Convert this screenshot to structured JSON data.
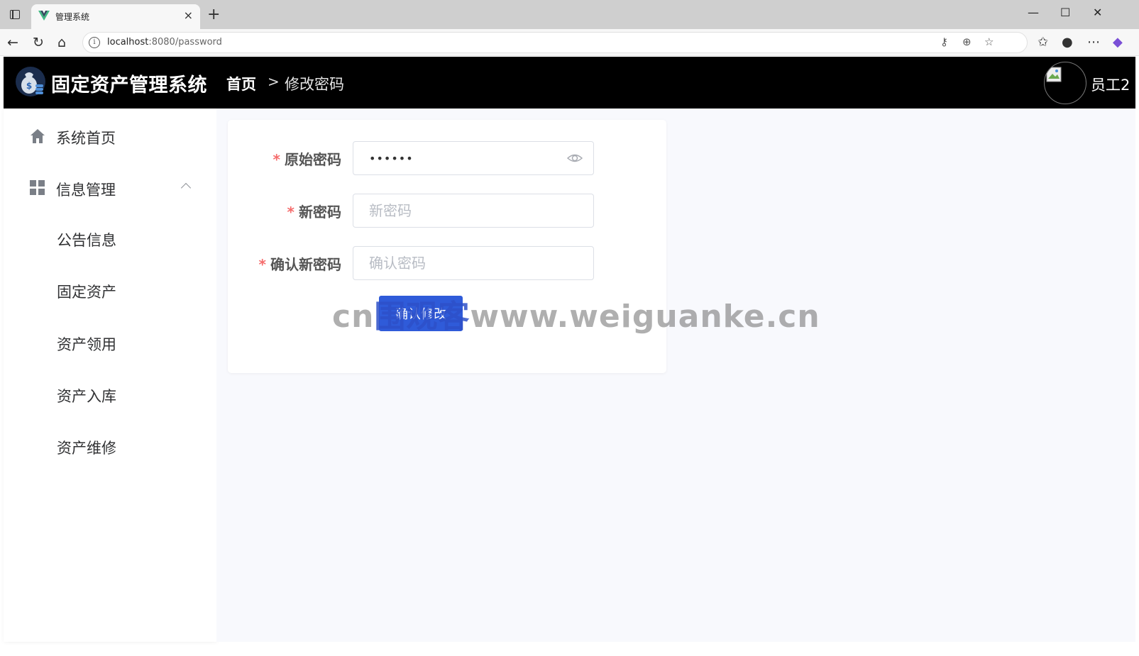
{
  "browser": {
    "tab_title": "管理系统",
    "tab_close": "×",
    "new_tab": "+",
    "url_host": "localhost",
    "url_rest": ":8080/password",
    "window_controls": {
      "minimize": "—",
      "maximize": "☐",
      "close": "✕"
    }
  },
  "header": {
    "app_title": "固定资产管理系统",
    "breadcrumb": {
      "home": "首页",
      "separator": ">",
      "current": "修改密码"
    },
    "user_name": "员工2"
  },
  "sidebar": {
    "items": [
      {
        "label": "系统首页",
        "icon": "home-icon"
      },
      {
        "label": "信息管理",
        "icon": "grid-icon",
        "expanded": true
      }
    ],
    "sub_items": [
      {
        "label": "公告信息"
      },
      {
        "label": "固定资产"
      },
      {
        "label": "资产领用"
      },
      {
        "label": "资产入库"
      },
      {
        "label": "资产维修"
      }
    ]
  },
  "form": {
    "required_mark": "*",
    "fields": [
      {
        "label": "原始密码",
        "value": "••••••",
        "placeholder": ""
      },
      {
        "label": "新密码",
        "value": "",
        "placeholder": "新密码"
      },
      {
        "label": "确认新密码",
        "value": "",
        "placeholder": "确认密码"
      }
    ],
    "submit_label": "确认修改"
  },
  "watermark": {
    "prefix": "cn",
    "middle": "围观客",
    "suffix": "www.weiguanke.cn"
  },
  "colors": {
    "header_bg": "#000000",
    "primary": "#2f5bd9",
    "required": "#f56c6c",
    "main_bg": "#f8f9fd"
  }
}
